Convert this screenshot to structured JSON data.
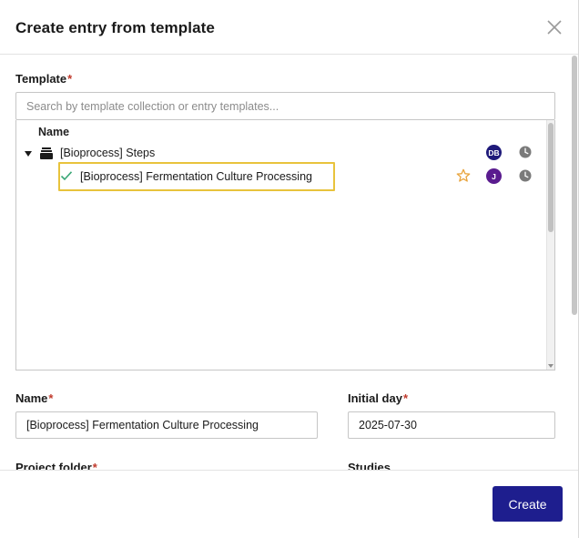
{
  "dialog": {
    "title": "Create entry from template",
    "close_icon": "close-icon"
  },
  "template": {
    "label": "Template",
    "required_mark": "*",
    "search_placeholder": "Search by template collection or entry templates...",
    "column_header": "Name",
    "tree": [
      {
        "label": "[Bioprocess] Steps",
        "icon": "stack-icon",
        "expanded": true,
        "avatar": "DB",
        "avatar_color": "#1f1a7a",
        "clock_icon": "clock-icon"
      },
      {
        "label": "[Bioprocess] Fermentation Culture Processing",
        "icon": "check-icon",
        "selected": true,
        "star_icon": "star-outline-icon",
        "avatar": "J",
        "avatar_color": "#5a1c8f",
        "clock_icon": "clock-icon"
      }
    ]
  },
  "name": {
    "label": "Name",
    "required_mark": "*",
    "value": "[Bioprocess] Fermentation Culture Processing"
  },
  "initial_day": {
    "label": "Initial day",
    "required_mark": "*",
    "value": "2025-07-30"
  },
  "project_folder": {
    "label": "Project folder",
    "required_mark": "*"
  },
  "studies": {
    "label": "Studies"
  },
  "footer": {
    "create_label": "Create"
  },
  "colors": {
    "accent": "#1e1e8e",
    "selection_outline": "#e8c33c",
    "check": "#3aa776",
    "star": "#e8a33c",
    "required": "#c0392b"
  }
}
